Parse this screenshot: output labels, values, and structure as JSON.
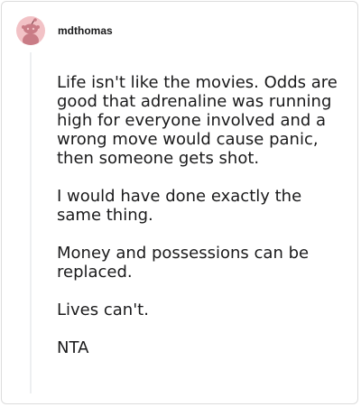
{
  "comment": {
    "username": "mdthomas",
    "avatar_icon": "reddit-snoo-avatar-icon",
    "paragraphs": [
      "Life isn't like the movies. Odds are good that adrenaline was running high for everyone involved and a wrong move would cause panic, then someone gets shot.",
      "I would have done exactly the same thing.",
      "Money and possessions can be replaced.",
      "Lives can't.",
      "NTA"
    ]
  },
  "colors": {
    "avatar_bg": "#f2c2c6",
    "text": "#1a1a1b",
    "border": "#dcdcdc",
    "thread_line": "#edeff1"
  }
}
